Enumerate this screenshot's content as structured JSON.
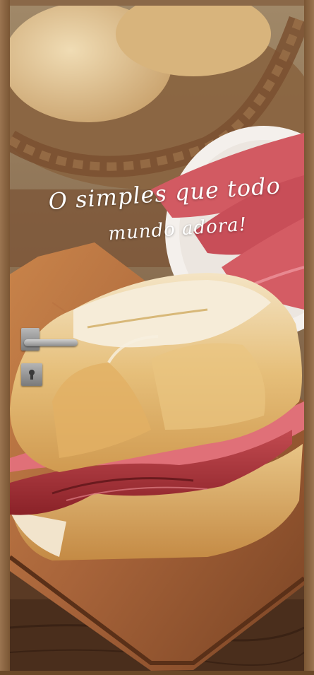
{
  "headline": {
    "line1": "O simples que todo",
    "line2": "mundo adora!"
  },
  "colors": {
    "text": "#ffffff",
    "wood": "#7a5434",
    "bread": "#e8c27a",
    "ham": "#a8323a"
  },
  "icons": {
    "door_handle": "door-lever-handle-icon",
    "keyhole": "keyhole-lock-icon"
  }
}
